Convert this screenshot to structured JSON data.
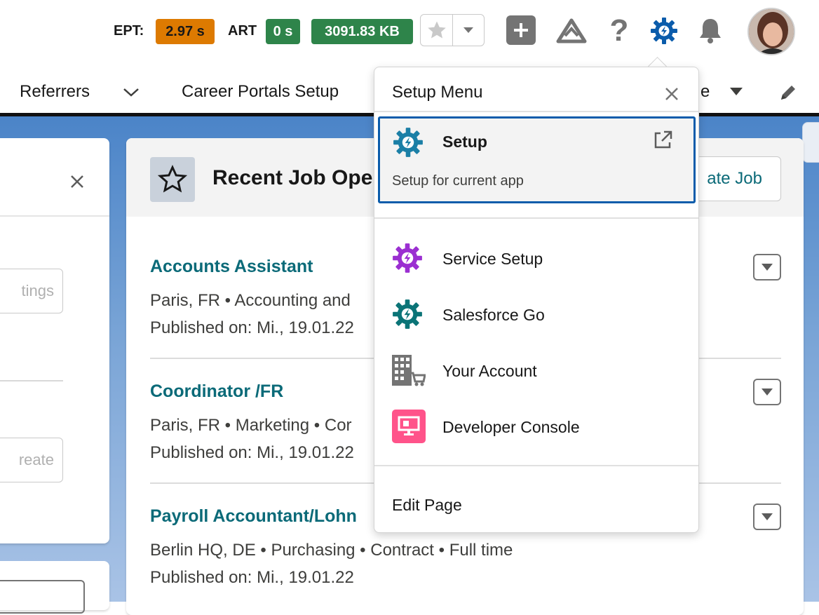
{
  "header": {
    "ept_label": "EPT:",
    "ept_value": "2.97 s",
    "art_label": "ART",
    "art_value": "0 s",
    "size_value": "3091.83 KB",
    "colors": {
      "ept": "#dd7a01",
      "art": "#2e844a",
      "size": "#2e844a",
      "setup_icon": "#0b5cab"
    }
  },
  "nav": {
    "items": [
      "Referrers",
      "Career Portals Setup"
    ],
    "partial_item": "e"
  },
  "left_card": {
    "button_1": "tings",
    "button_2": "reate"
  },
  "main_card": {
    "title": "Recent Job Ope",
    "create_button": "ate Job",
    "jobs": [
      {
        "title": "Accounts Assistant",
        "meta": "Paris, FR • Accounting and",
        "published": "Published on: Mi., 19.01.22"
      },
      {
        "title": "Coordinator /FR",
        "meta": "Paris, FR • Marketing • Cor",
        "published": "Published on: Mi., 19.01.22"
      },
      {
        "title": "Payroll Accountant/Lohn",
        "meta": "Berlin HQ, DE • Purchasing • Contract • Full time",
        "published": "Published on: Mi., 19.01.22"
      }
    ]
  },
  "setup_menu": {
    "title": "Setup Menu",
    "featured": {
      "label": "Setup",
      "description": "Setup for current app"
    },
    "items": [
      {
        "label": "Service Setup",
        "icon": "service-setup-gear-icon",
        "color": "#9b2fd1"
      },
      {
        "label": "Salesforce Go",
        "icon": "salesforce-go-gear-icon",
        "color": "#0b7477"
      },
      {
        "label": "Your Account",
        "icon": "building-cart-icon",
        "color": "#6b6b6b"
      },
      {
        "label": "Developer Console",
        "icon": "monitor-icon",
        "color": "#ff538a"
      }
    ],
    "footer": "Edit Page"
  }
}
